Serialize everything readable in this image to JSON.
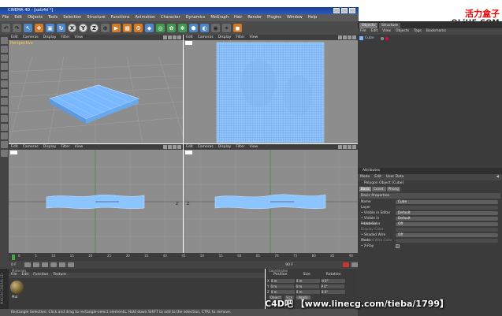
{
  "window": {
    "title": "CINEMA 4D - [solz4d *]"
  },
  "watermark": {
    "cn": "活力盒子",
    "en": "OLiHE.COM",
    "bottom": "C4D吧 【www.linecg.com/tieba/1799】"
  },
  "menu": [
    "File",
    "Edit",
    "Objects",
    "Tools",
    "Selection",
    "Structure",
    "Functions",
    "Animation",
    "Character",
    "Dynamics",
    "MoGraph",
    "Hair",
    "Render",
    "Plugins",
    "Window",
    "Help"
  ],
  "toolbar_letters": [
    "X",
    "Y",
    "Z"
  ],
  "viewports": [
    {
      "menu": [
        "Edit",
        "Cameras",
        "Display",
        "Filter",
        "View"
      ],
      "label": "Perspective"
    },
    {
      "menu": [
        "Edit",
        "Cameras",
        "Display",
        "Filter",
        "View"
      ],
      "label": ""
    },
    {
      "menu": [
        "Edit",
        "Cameras",
        "Display",
        "Filter",
        "View"
      ],
      "label": ""
    },
    {
      "menu": [
        "Edit",
        "Cameras",
        "Display",
        "Filter",
        "View"
      ],
      "label": ""
    }
  ],
  "axis_labels": {
    "x": "X",
    "y": "Y",
    "z": "Z"
  },
  "timeline": {
    "ticks": [
      "0",
      "5",
      "10",
      "15",
      "20",
      "25",
      "30",
      "35",
      "40",
      "45",
      "50",
      "55",
      "60",
      "65",
      "70",
      "75",
      "80",
      "85",
      "90"
    ],
    "frame": "0 F",
    "end": "90 F"
  },
  "materials": {
    "menu": [
      "File",
      "Edit",
      "Function",
      "Texture"
    ],
    "title": "Materials",
    "swatch": "Mat"
  },
  "coordinates": {
    "title": "Coordinates",
    "cols": [
      "Position",
      "Size",
      "Rotation"
    ],
    "rows": [
      {
        "axis": "X",
        "pos": "0 m",
        "size": "0 m",
        "rot": "H 0°"
      },
      {
        "axis": "Y",
        "pos": "0 m",
        "size": "0 m",
        "rot": "P 0°"
      },
      {
        "axis": "Z",
        "pos": "0 m",
        "size": "0 m",
        "rot": "B 0°"
      }
    ],
    "mode": "Object",
    "mode2": "Size",
    "apply": "Apply"
  },
  "status": "Rectangle Selection: Click and drag to rectangle-select elements. Hold down SHIFT to add to the selection, CTRL to remove.",
  "objects_panel": {
    "tabs": [
      "Objects",
      "Structure"
    ],
    "menu": [
      "File",
      "Edit",
      "View",
      "Objects",
      "Tags",
      "Bookmarks"
    ],
    "object": "Cube"
  },
  "attributes": {
    "title": "Attributes",
    "menu": [
      "Mode",
      "Edit",
      "User Data"
    ],
    "object_line": "Polygon Object [Cube]",
    "tabs": [
      "Basic",
      "Coord.",
      "Phong"
    ],
    "section": "Basic Properties",
    "props": [
      {
        "label": "Name",
        "value": "Cube"
      },
      {
        "label": "Layer",
        "value": ""
      },
      {
        "label": "• Visible in Editor",
        "value": "Default"
      },
      {
        "label": "• Visible in Renderer",
        "value": "Default"
      },
      {
        "label": "• Use Color",
        "value": "Off"
      },
      {
        "label": "Display Color",
        "value": ""
      },
      {
        "label": "• Shaded Wire Mode",
        "value": "Off"
      },
      {
        "label": "Shaded Wire Color",
        "value": ""
      },
      {
        "label": "• X-Ray",
        "value": ""
      }
    ]
  },
  "colors": {
    "mesh": "#7ab8ff",
    "viewport_bg": "#8d8d8d",
    "panel": "#3b3b3b"
  }
}
